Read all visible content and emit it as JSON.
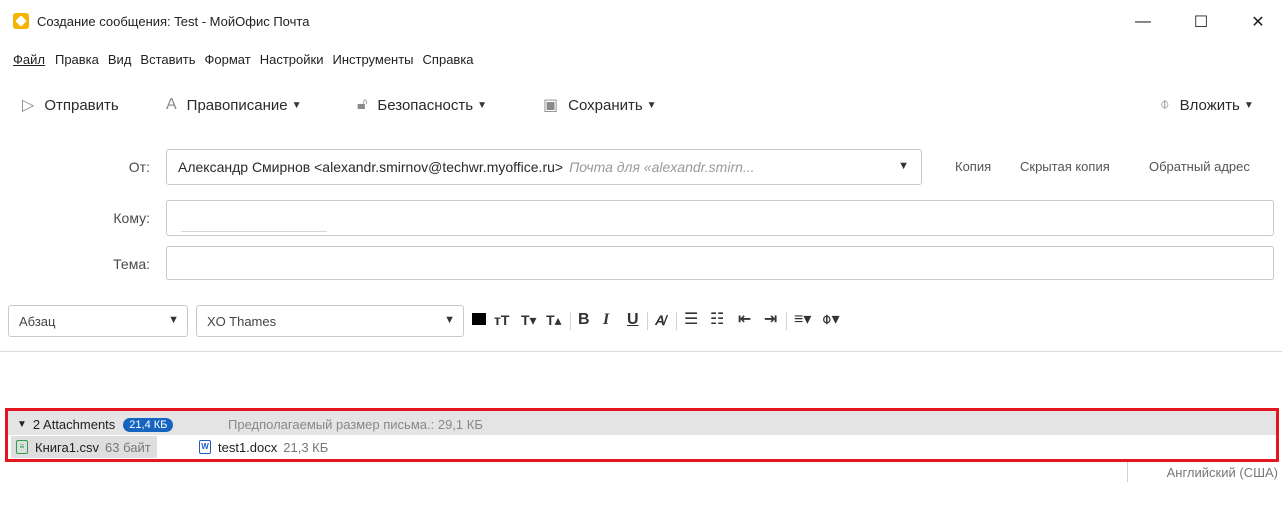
{
  "window": {
    "title": "Создание сообщения: Test - МойОфис Почта",
    "minimize": "—",
    "maximize": "☐",
    "close": "✕"
  },
  "menu": [
    "Файл",
    "Правка",
    "Вид",
    "Вставить",
    "Формат",
    "Настройки",
    "Инструменты",
    "Справка"
  ],
  "toolbar": {
    "send": "Отправить",
    "spelling": "Правописание",
    "security": "Безопасность",
    "save": "Сохранить",
    "attach": "Вложить"
  },
  "header": {
    "from_label": "От:",
    "from_value": "Александр Смирнов <alexandr.smirnov@techwr.myoffice.ru>",
    "from_hint": "Почта для «alexandr.smirn...",
    "cc": "Копия",
    "bcc": "Скрытая копия",
    "reply_to": "Обратный адрес",
    "to_label": "Кому:",
    "subject_label": "Тема:"
  },
  "format": {
    "paragraph_style": "Абзац",
    "font": "XO Thames"
  },
  "attachments": {
    "title": "2 Attachments",
    "total_size": "21,4 КБ",
    "estimated": "Предполагаемый размер письма.: 29,1 КБ",
    "files": [
      {
        "name": "Книга1.csv",
        "size": "63 байт",
        "icon": "spreadsheet-file-icon",
        "color": "#2e9d4b"
      },
      {
        "name": "test1.docx",
        "size": "21,3 КБ",
        "icon": "document-file-icon",
        "color": "#1e5bc6"
      }
    ]
  },
  "status": {
    "language": "Английский (США)"
  },
  "colors": {
    "highlight_border": "#e3161f",
    "badge": "#1565c0"
  }
}
